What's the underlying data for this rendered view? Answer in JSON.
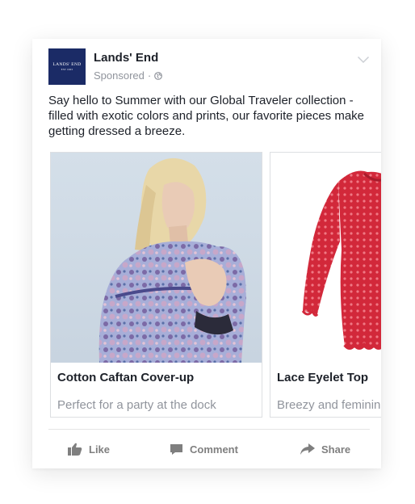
{
  "post": {
    "page_name": "Lands' End",
    "sponsored_label": "Sponsored",
    "sponsored_separator": "·",
    "logo_text": "LANDS' END",
    "logo_subtext": "EST 1963",
    "body_text": "Say hello to Summer with our Global Traveler collection - filled with exotic colors and prints, our favorite pieces make getting dressed a breeze."
  },
  "carousel": [
    {
      "title": "Cotton Caftan Cover-up",
      "description": "Perfect for a party at the dock",
      "image": "model-in-paisley-caftan"
    },
    {
      "title": "Lace Eyelet Top",
      "description": "Breezy and feminine",
      "image": "red-lace-eyelet-top"
    }
  ],
  "actions": {
    "like": "Like",
    "comment": "Comment",
    "share": "Share"
  },
  "colors": {
    "brand_navy": "#1b2b66",
    "text_dark": "#1d2129",
    "text_muted": "#90949c",
    "action_gray": "#7f7f7f",
    "top_red": "#d2283a"
  },
  "icons": [
    "chevron-down-icon",
    "globe-icon",
    "thumbs-up-icon",
    "comment-icon",
    "share-icon"
  ]
}
